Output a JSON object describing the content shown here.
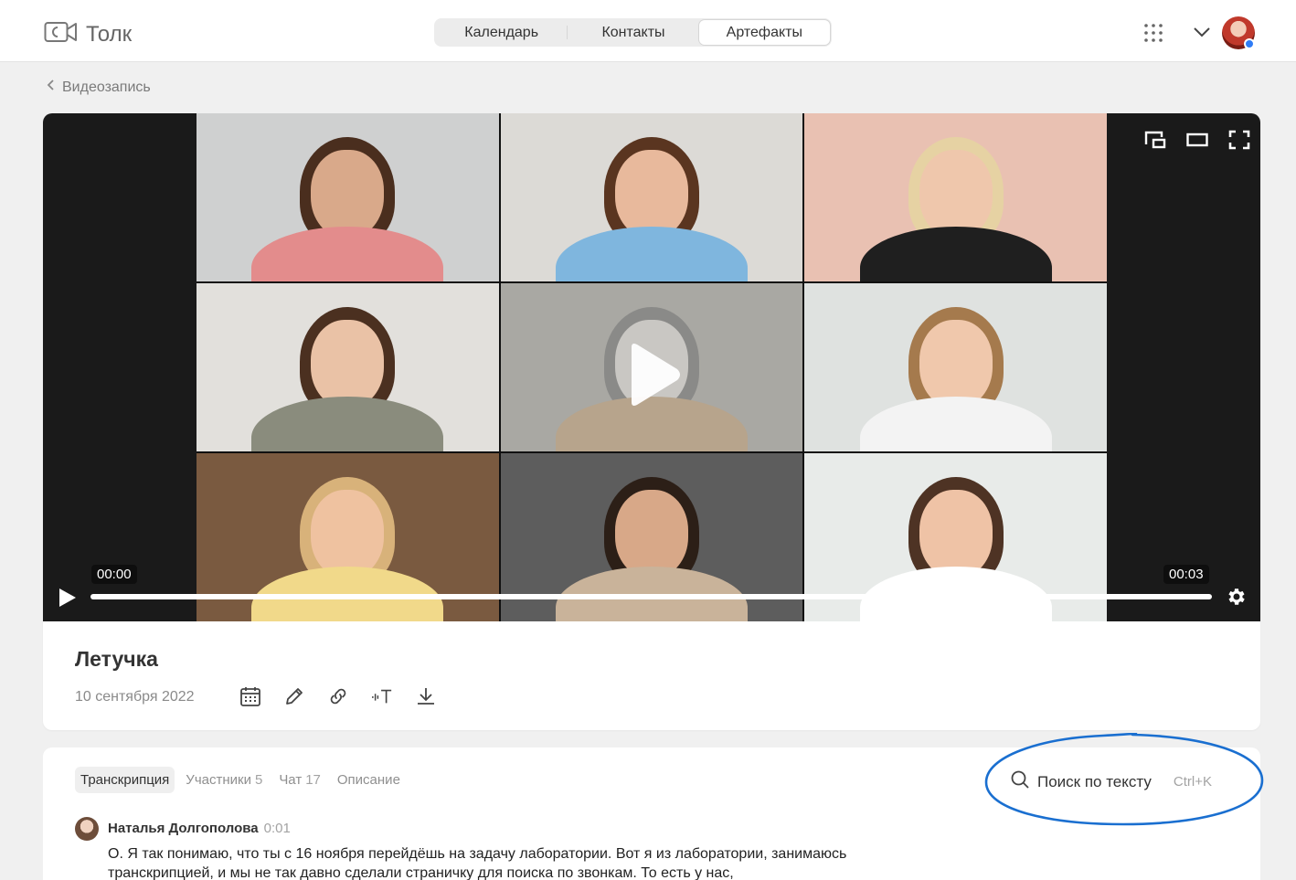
{
  "app": {
    "name": "Толк",
    "logo_icon": "video-camera-icon"
  },
  "nav": {
    "tabs": [
      {
        "label": "Календарь",
        "active": false
      },
      {
        "label": "Контакты",
        "active": false
      },
      {
        "label": "Артефакты",
        "active": true
      }
    ]
  },
  "header": {
    "apps_icon": "grid-icon",
    "menu_icon": "chevron-down-icon",
    "status_color": "#2f7cf6"
  },
  "breadcrumb": {
    "label": "Видеозапись"
  },
  "player": {
    "time_current": "00:00",
    "time_total": "00:03",
    "progress": 0,
    "controls": [
      "pip-icon",
      "theater-icon",
      "fullscreen-icon",
      "settings-icon",
      "play-icon"
    ]
  },
  "recording": {
    "title": "Летучка",
    "date": "10 сентября 2022",
    "actions": [
      "calendar-icon",
      "edit-icon",
      "link-icon",
      "transcript-icon",
      "download-icon"
    ]
  },
  "transcript_tabs": [
    {
      "label": "Транскрипция",
      "count": "",
      "active": true
    },
    {
      "label": "Участники",
      "count": "5",
      "active": false
    },
    {
      "label": "Чат",
      "count": "17",
      "active": false
    },
    {
      "label": "Описание",
      "count": "",
      "active": false
    }
  ],
  "search": {
    "label": "Поиск по тексту",
    "shortcut": "Ctrl+K"
  },
  "message": {
    "author": "Наталья Долгополова",
    "time": "0:01",
    "text": "О. Я так понимаю, что ты с 16 ноября перейдёшь на задачу лаборатории. Вот я из лаборатории, занимаюсь транскрипцией, и мы не так давно сделали страничку для поиска по звонкам. То есть у нас,"
  }
}
